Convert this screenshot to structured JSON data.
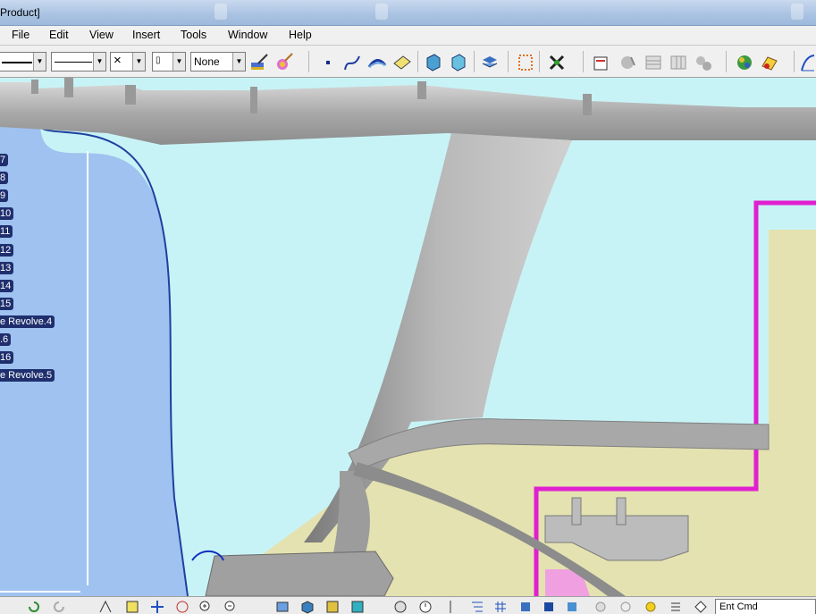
{
  "window": {
    "title": "Product]"
  },
  "menu": {
    "items": [
      "File",
      "Edit",
      "View",
      "Insert",
      "Tools",
      "Window",
      "Help"
    ]
  },
  "toolbar": {
    "line_weight_value": "",
    "line_type_value": "",
    "point_type_value": "×",
    "layer_value": "None",
    "icons": [
      "painter-brush-icon",
      "sphere-palette-icon",
      "point-icon",
      "spline-icon",
      "arc-icon",
      "surface-icon",
      "catalog-part-icon",
      "catalog-part2-icon",
      "assembly-explode-icon",
      "grid-icon",
      "fix-together-icon",
      "properties-icon",
      "knowledge-icon",
      "table-icon",
      "table2-icon",
      "gears-icon",
      "globe-icon",
      "render-icon",
      "sketch-icon"
    ]
  },
  "tree": {
    "labels": [
      "7",
      "8",
      "9",
      "10",
      "11",
      "12",
      "13",
      "14",
      "15",
      "e Revolve.4",
      ".6",
      "16",
      "e Revolve.5"
    ]
  },
  "bottombar": {
    "field_value": "Ent  Cmd"
  },
  "colors": {
    "viewport_bg": "#c8f3f6",
    "tree_label_bg": "#1f2f6e",
    "magenta_path": "#e020d0",
    "part_grey": "#9a9a9a",
    "terrain_yellow": "#e4e2b0"
  }
}
